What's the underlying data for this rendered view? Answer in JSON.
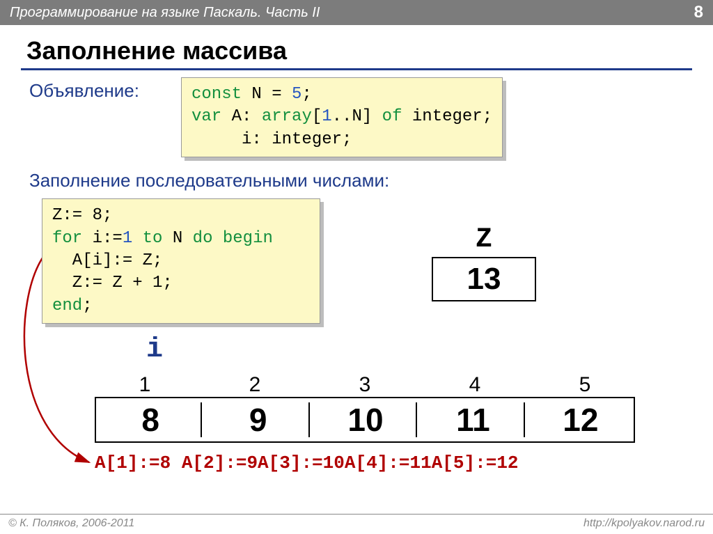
{
  "header": {
    "subject": "Программирование на языке Паскаль. Часть II",
    "page": "8"
  },
  "title": "Заполнение массива",
  "label_declaration": "Объявление:",
  "code1": {
    "l1_a": "const",
    "l1_b": " N = ",
    "l1_c": "5",
    "l1_d": ";",
    "l2_a": "var",
    "l2_b": " A: ",
    "l2_c": "array",
    "l2_d": "[",
    "l2_e": "1",
    "l2_f": "..N] ",
    "l2_g": "of",
    "l2_h": " integer;",
    "l3": "     i: integer;"
  },
  "label_fill": "Заполнение последовательными числами:",
  "code2": {
    "l1": "Z:= 8;",
    "l2_a": "for",
    "l2_b": " i:=",
    "l2_c": "1",
    "l2_d": " ",
    "l2_e": "to",
    "l2_f": " N ",
    "l2_g": "do begin",
    "l3": "  A[i]:= Z;",
    "l4": "  Z:= Z + 1;",
    "l5": "end",
    "l5b": ";"
  },
  "z": {
    "label": "Z",
    "value": "13"
  },
  "i_label": "i",
  "array": {
    "indices": [
      "1",
      "2",
      "3",
      "4",
      "5"
    ],
    "values": [
      "8",
      "9",
      "10",
      "11",
      "12"
    ]
  },
  "assignments": [
    "A[1]:=8",
    "A[2]:=9",
    "A[3]:=10",
    "A[4]:=11",
    "A[5]:=12"
  ],
  "assign_text": "A[1]:=8 A[2]:=9A[3]:=10A[4]:=11A[5]:=12",
  "footer": {
    "left": "© К. Поляков, 2006-2011",
    "right": "http://kpolyakov.narod.ru"
  }
}
